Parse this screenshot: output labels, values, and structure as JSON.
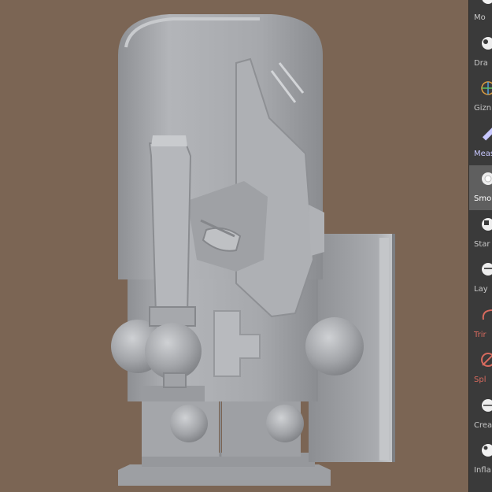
{
  "viewport": {
    "background": "#7b6554",
    "model": "sculpted knight figurine with sword and shield"
  },
  "tools": [
    {
      "label": "Mo",
      "icon": "move-brush-icon",
      "state": "normal"
    },
    {
      "label": "Dra",
      "icon": "draw-brush-icon",
      "state": "normal"
    },
    {
      "label": "Gizn",
      "icon": "gizmo-icon",
      "state": "normal"
    },
    {
      "label": "Meas",
      "icon": "measure-icon",
      "state": "blue"
    },
    {
      "label": "Smo",
      "icon": "smooth-brush-icon",
      "state": "active"
    },
    {
      "label": "Star",
      "icon": "stamp-brush-icon",
      "state": "normal"
    },
    {
      "label": "Lay",
      "icon": "layer-brush-icon",
      "state": "normal"
    },
    {
      "label": "Trir",
      "icon": "trim-brush-icon",
      "state": "warn"
    },
    {
      "label": "Spl",
      "icon": "split-brush-icon",
      "state": "warn"
    },
    {
      "label": "Crea",
      "icon": "crease-brush-icon",
      "state": "normal"
    },
    {
      "label": "Infla",
      "icon": "inflate-brush-icon",
      "state": "normal"
    }
  ],
  "colors": {
    "panel": "#3a3a3a",
    "active": "#5f5f5f",
    "warn": "#d76a5e",
    "model": "#a9abaf"
  }
}
